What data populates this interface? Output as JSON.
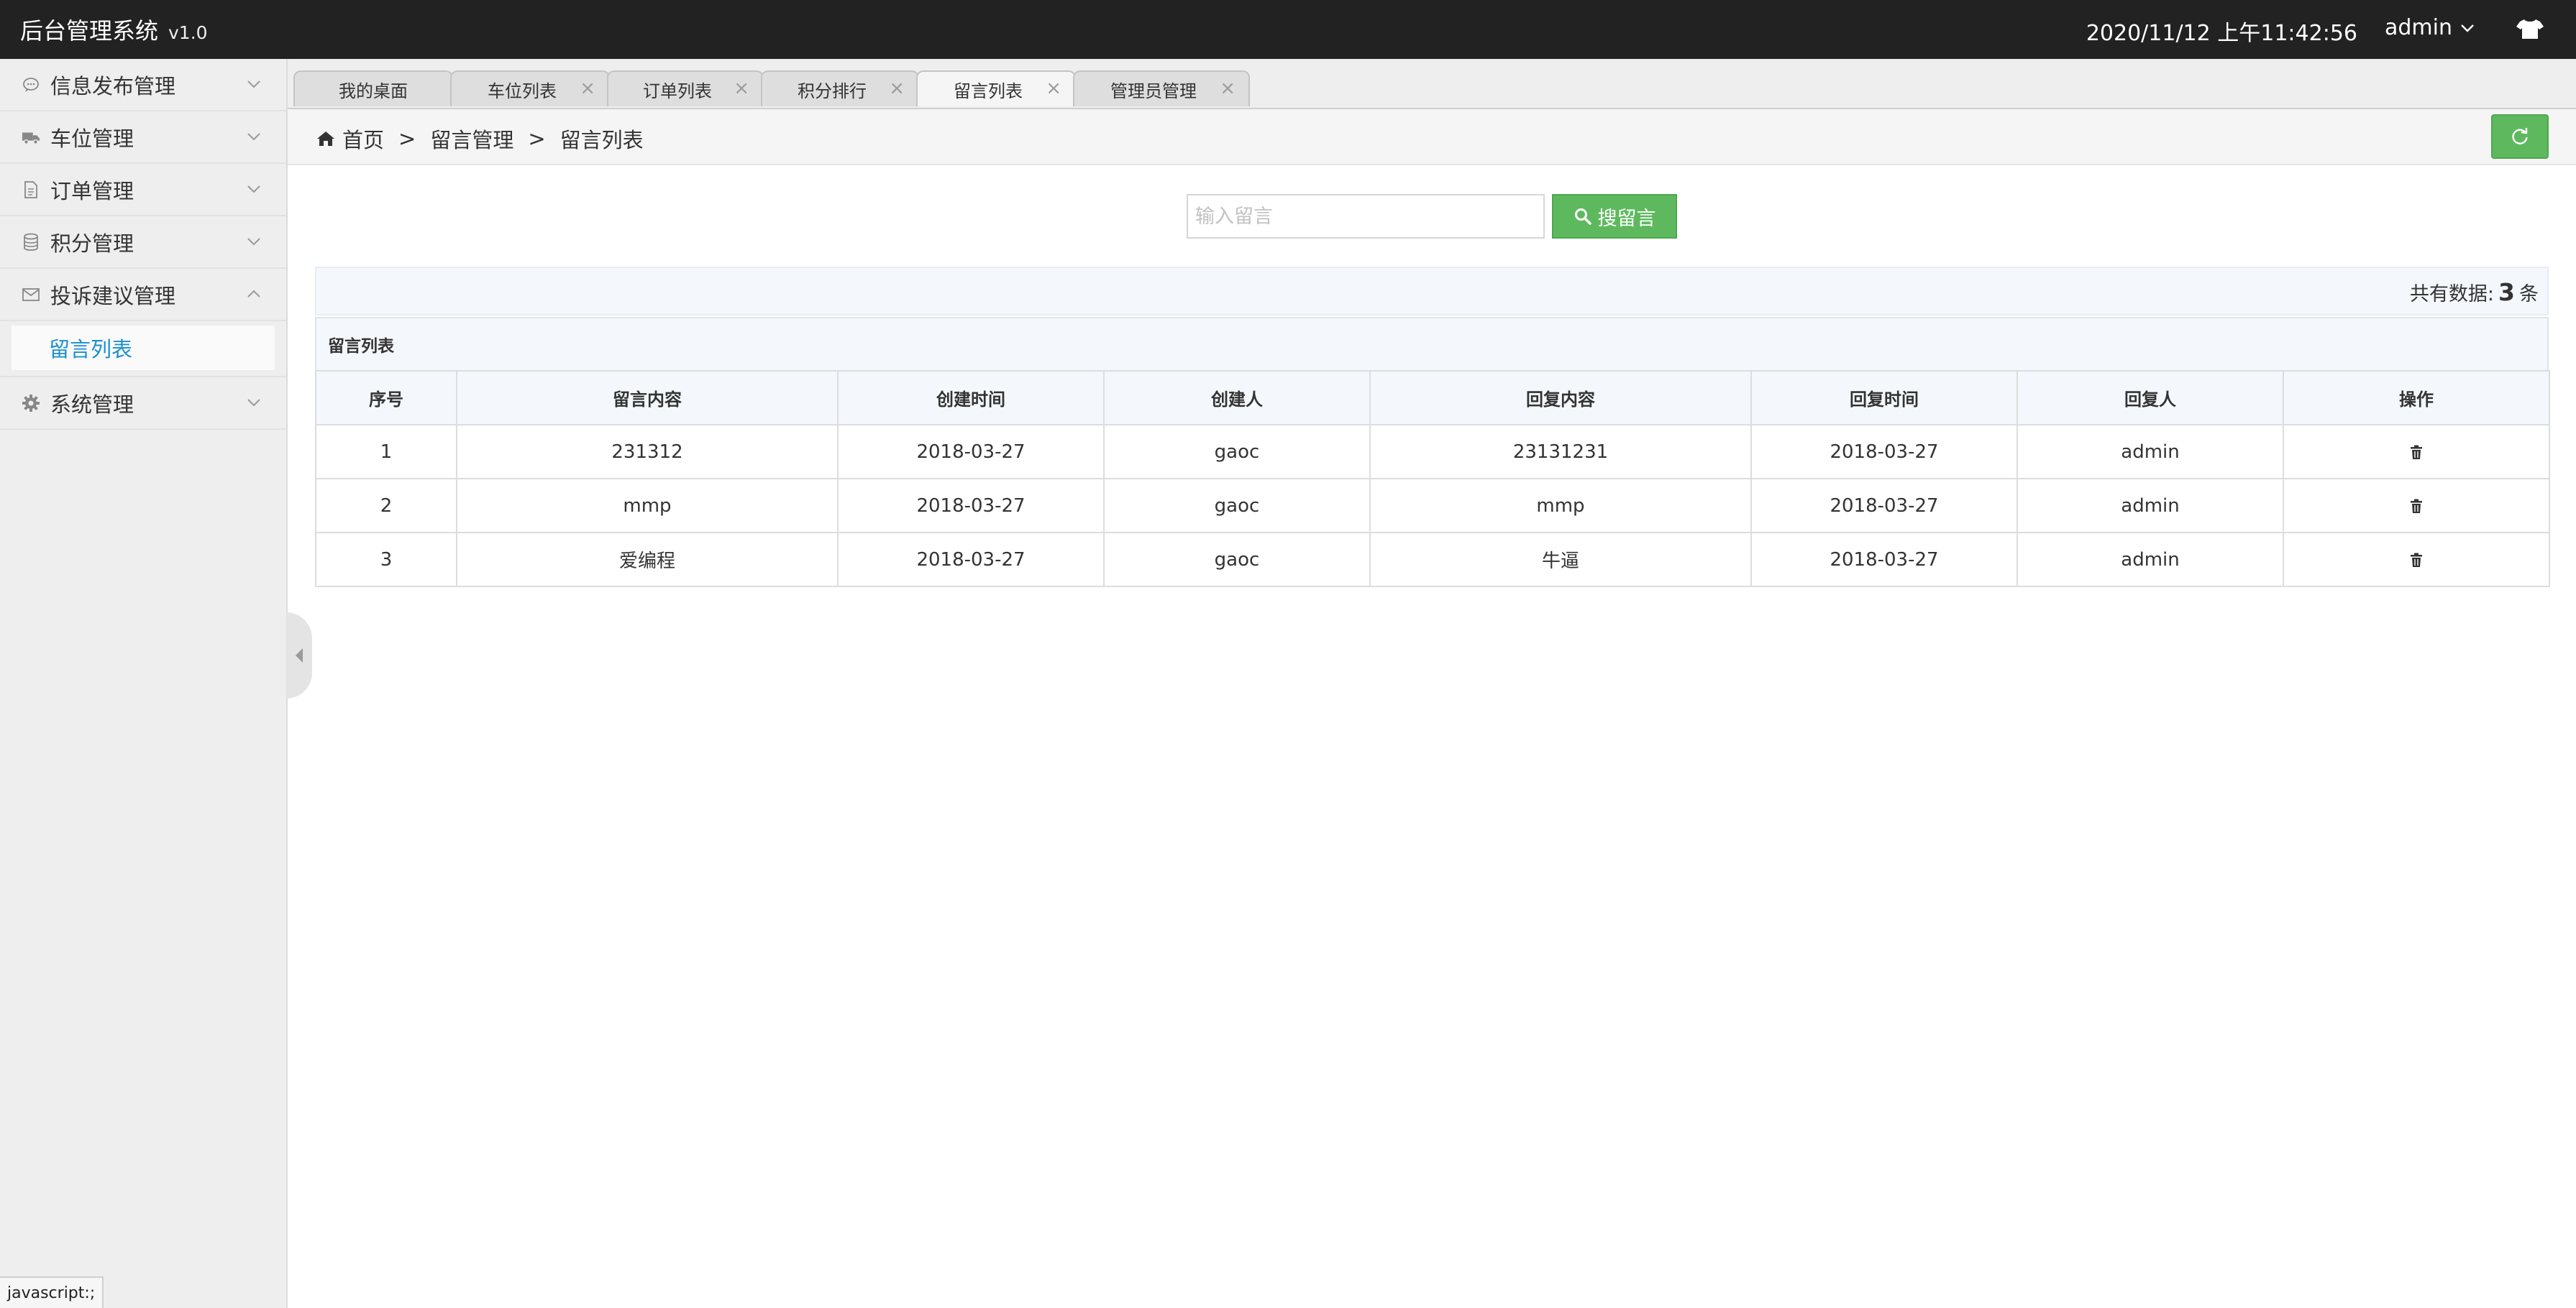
{
  "header": {
    "title": "后台管理系统",
    "version": "v1.0",
    "datetime": "2020/11/12 上午11:42:56",
    "user": "admin",
    "user_icon": "chevron-down-icon",
    "skin_icon": "tshirt-icon"
  },
  "sidebar": {
    "items": [
      {
        "label": "信息发布管理",
        "icon": "comment-icon",
        "expanded": false
      },
      {
        "label": "车位管理",
        "icon": "truck-icon",
        "expanded": false
      },
      {
        "label": "订单管理",
        "icon": "document-icon",
        "expanded": false
      },
      {
        "label": "积分管理",
        "icon": "database-icon",
        "expanded": false
      },
      {
        "label": "投诉建议管理",
        "icon": "envelope-icon",
        "expanded": true,
        "children": [
          {
            "label": "留言列表",
            "active": true
          }
        ]
      },
      {
        "label": "系统管理",
        "icon": "gear-icon",
        "expanded": false
      }
    ]
  },
  "tabs": [
    {
      "label": "我的桌面",
      "closable": false,
      "active": false
    },
    {
      "label": "车位列表",
      "closable": true,
      "active": false
    },
    {
      "label": "订单列表",
      "closable": true,
      "active": false
    },
    {
      "label": "积分排行",
      "closable": true,
      "active": false
    },
    {
      "label": "留言列表",
      "closable": true,
      "active": true
    },
    {
      "label": "管理员管理",
      "closable": true,
      "active": false
    }
  ],
  "tab_close_glyph": "×",
  "breadcrumb": {
    "items": [
      "首页",
      "留言管理",
      "留言列表"
    ],
    "separator": ">"
  },
  "search": {
    "placeholder": "输入留言",
    "value": "",
    "button_label": "搜留言"
  },
  "count": {
    "prefix": "共有数据:",
    "value": "3",
    "suffix": "条"
  },
  "table": {
    "caption": "留言列表",
    "headers": [
      "序号",
      "留言内容",
      "创建时间",
      "创建人",
      "回复内容",
      "回复时间",
      "回复人",
      "操作"
    ],
    "rows": [
      [
        "1",
        "231312",
        "2018-03-27",
        "gaoc",
        "23131231",
        "2018-03-27",
        "admin"
      ],
      [
        "2",
        "mmp",
        "2018-03-27",
        "gaoc",
        "mmp",
        "2018-03-27",
        "admin"
      ],
      [
        "3",
        "爱编程",
        "2018-03-27",
        "gaoc",
        "牛逼",
        "2018-03-27",
        "admin"
      ]
    ],
    "row_action_icon": "trash-icon"
  },
  "status_tip": "javascript:;",
  "colors": {
    "header_bg": "#222222",
    "accent_green": "#5eb95e",
    "link_blue": "#1a8fd0",
    "sidebar_bg": "#eeeeee"
  }
}
